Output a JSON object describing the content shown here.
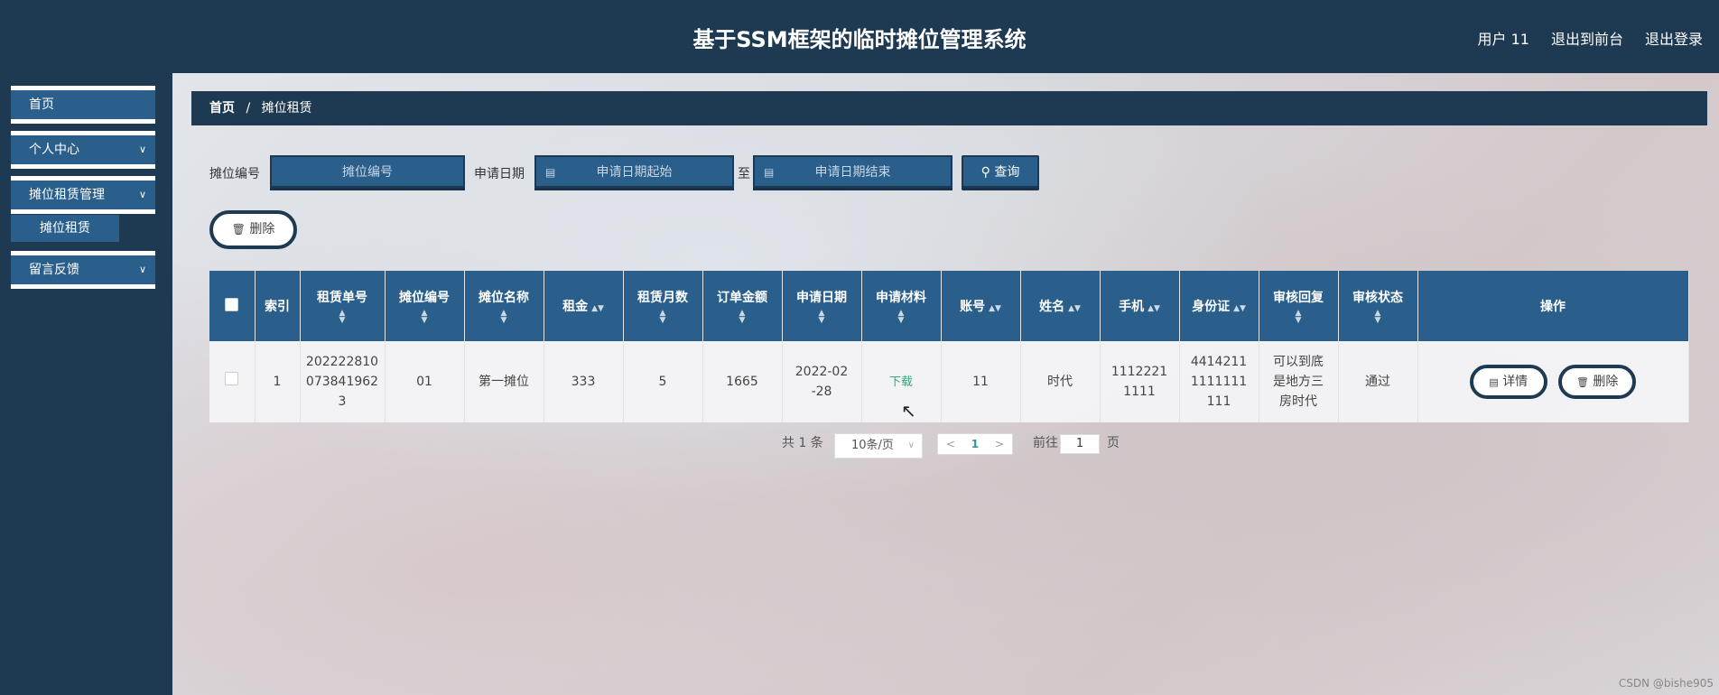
{
  "header": {
    "title": "基于SSM框架的临时摊位管理系统",
    "user": "用户 11",
    "to_front": "退出到前台",
    "logout": "退出登录"
  },
  "sidebar": {
    "items": [
      {
        "label": "首页"
      },
      {
        "label": "个人中心",
        "expand_icon": "chevron-down-icon"
      },
      {
        "label": "摊位租赁管理",
        "expand_icon": "chevron-down-icon"
      },
      {
        "label": "摊位租赁"
      },
      {
        "label": "留言反馈",
        "expand_icon": "chevron-down-icon"
      }
    ]
  },
  "breadcrumb": {
    "home": "首页",
    "sep": "/",
    "current": "摊位租赁"
  },
  "search": {
    "booth_no_label": "摊位编号",
    "booth_no_placeholder": "摊位编号",
    "date_label": "申请日期",
    "date_start_placeholder": "申请日期起始",
    "date_to": "至",
    "date_end_placeholder": "申请日期结束",
    "query_button": "查询"
  },
  "actions": {
    "delete_button": "删除"
  },
  "table": {
    "headers": [
      "索引",
      "租赁单号",
      "摊位编号",
      "摊位名称",
      "租金",
      "租赁月数",
      "订单金额",
      "申请日期",
      "申请材料",
      "账号",
      "姓名",
      "手机",
      "身份证",
      "审核回复",
      "审核状态",
      "操作"
    ],
    "rows": [
      {
        "index": "1",
        "order_no": "2022228100738419623",
        "booth_no": "01",
        "booth_name": "第一摊位",
        "rent": "333",
        "months": "5",
        "amount": "1665",
        "date": "2022-02-28",
        "material": "下载",
        "account": "11",
        "name": "时代",
        "phone": "11122211111",
        "id_card": "44142111111111111",
        "reply": "可以到底是地方三房时代",
        "status": "通过",
        "detail_button": "详情",
        "delete_button": "删除"
      }
    ]
  },
  "pagination": {
    "total": "共 1 条",
    "page_size": "10条/页",
    "current_page": "1",
    "goto_label": "前往",
    "goto_value": "1",
    "page_suffix": "页"
  },
  "watermark": "CSDN @bishe905",
  "colors": {
    "primary": "#1e3a52",
    "accent": "#2a5f8c",
    "link": "#3aa67b"
  }
}
